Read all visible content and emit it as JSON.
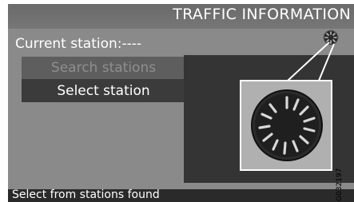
{
  "screen": {
    "title": "TRAFFIC INFORMATION",
    "current_station": "Current station:----",
    "menu": {
      "search_stations": "Search stations",
      "select_station": "Select station"
    },
    "status": "Select from stations found"
  },
  "icons": {
    "status_indicator": "loading-spinner-icon",
    "zoom_indicator": "loading-spinner-icon"
  },
  "figure_code": "G032197",
  "colors": {
    "screen_bg": "#8a8a8a",
    "panel_bg": "#343434",
    "selected_item": "#3b3b3b",
    "disabled_item": "#5e5e5e",
    "callout": "#ffffff"
  }
}
